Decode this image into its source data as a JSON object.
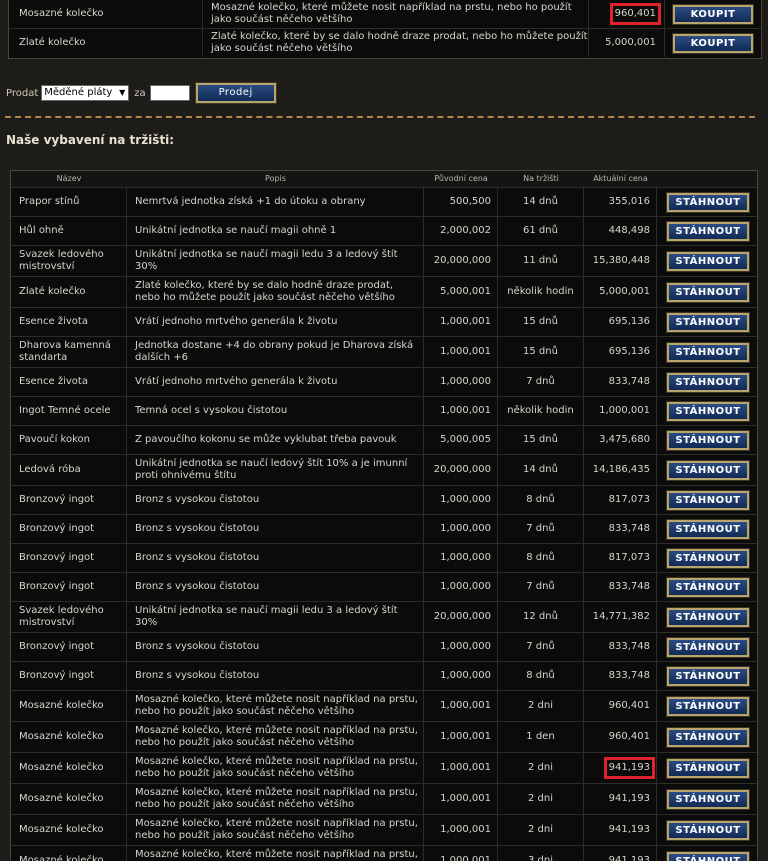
{
  "top_items": [
    {
      "name": "Mosazné kolečko",
      "desc": "Mosazné kolečko, které můžete nosit například na prstu, nebo ho použít jako součást něčeho většího",
      "price": "960,401",
      "button": "KOUPIT",
      "highlight": true
    },
    {
      "name": "Zlaté kolečko",
      "desc": "Zlaté kolečko, které by se dalo hodně draze prodat, nebo ho můžete použít jako součást něčeho většího",
      "price": "5,000,001",
      "button": "KOUPIT",
      "highlight": false
    }
  ],
  "sell": {
    "label": "Prodat",
    "selected": "Měděné pláty",
    "for_label": "za",
    "amount": "",
    "button": "Prodej"
  },
  "section_title": "Naše vybavení na tržišti:",
  "columns": {
    "name": "Název",
    "desc": "Popis",
    "orig": "Původní cena",
    "days": "Na tržišti",
    "current": "Aktuální cena"
  },
  "rows": [
    {
      "name": "Prapor stínů",
      "desc": "Nemrtvá jednotka získá +1 do útoku a obrany",
      "orig": "500,500",
      "days": "14 dnů",
      "current": "355,016",
      "button": "STÁHNOUT",
      "h": 28
    },
    {
      "name": "Hůl ohně",
      "desc": "Unikátní jednotka se naučí magii ohně 1",
      "orig": "2,000,002",
      "days": "61 dnů",
      "current": "448,498",
      "button": "STÁHNOUT",
      "h": 28
    },
    {
      "name": "Svazek ledového mistrovství",
      "desc": "Unikátní jednotka se naučí magii ledu 3 a ledový štít 30%",
      "orig": "20,000,000",
      "days": "11 dnů",
      "current": "15,380,448",
      "button": "STÁHNOUT",
      "h": 30
    },
    {
      "name": "Zlaté kolečko",
      "desc": "Zlaté kolečko, které by se dalo hodně draze prodat, nebo ho můžete použít jako součást něčeho většího",
      "orig": "5,000,001",
      "days": "několik hodin",
      "current": "5,000,001",
      "button": "STÁHNOUT",
      "h": 30
    },
    {
      "name": "Esence života",
      "desc": "Vrátí jednoho mrtvého generála k životu",
      "orig": "1,000,001",
      "days": "15 dnů",
      "current": "695,136",
      "button": "STÁHNOUT",
      "h": 28
    },
    {
      "name": "Dharova kamenná standarta",
      "desc": "Jednotka dostane +4 do obrany pokud je Dharova získá dalších +6",
      "orig": "1,000,001",
      "days": "15 dnů",
      "current": "695,136",
      "button": "STÁHNOUT",
      "h": 30
    },
    {
      "name": "Esence života",
      "desc": "Vrátí jednoho mrtvého generála k životu",
      "orig": "1,000,000",
      "days": "7 dnů",
      "current": "833,748",
      "button": "STÁHNOUT",
      "h": 28
    },
    {
      "name": "Ingot Temné ocele",
      "desc": "Temná ocel s vysokou čistotou",
      "orig": "1,000,001",
      "days": "několik hodin",
      "current": "1,000,001",
      "button": "STÁHNOUT",
      "h": 28
    },
    {
      "name": "Pavoučí kokon",
      "desc": "Z pavoučího kokonu se může vyklubat třeba pavouk",
      "orig": "5,000,005",
      "days": "15 dnů",
      "current": "3,475,680",
      "button": "STÁHNOUT",
      "h": 28
    },
    {
      "name": "Ledová róba",
      "desc": "Unikátní jednotka se naučí ledový štít 10% a je imunní proti ohnivému štítu",
      "orig": "20,000,000",
      "days": "14 dnů",
      "current": "14,186,435",
      "button": "STÁHNOUT",
      "h": 30
    },
    {
      "name": "Bronzový ingot",
      "desc": "Bronz s vysokou čistotou",
      "orig": "1,000,000",
      "days": "8 dnů",
      "current": "817,073",
      "button": "STÁHNOUT",
      "h": 28
    },
    {
      "name": "Bronzový ingot",
      "desc": "Bronz s vysokou čistotou",
      "orig": "1,000,000",
      "days": "7 dnů",
      "current": "833,748",
      "button": "STÁHNOUT",
      "h": 28
    },
    {
      "name": "Bronzový ingot",
      "desc": "Bronz s vysokou čistotou",
      "orig": "1,000,000",
      "days": "8 dnů",
      "current": "817,073",
      "button": "STÁHNOUT",
      "h": 28
    },
    {
      "name": "Bronzový ingot",
      "desc": "Bronz s vysokou čistotou",
      "orig": "1,000,000",
      "days": "7 dnů",
      "current": "833,748",
      "button": "STÁHNOUT",
      "h": 28
    },
    {
      "name": "Svazek ledového mistrovství",
      "desc": "Unikátní jednotka se naučí magii ledu 3 a ledový štít 30%",
      "orig": "20,000,000",
      "days": "12 dnů",
      "current": "14,771,382",
      "button": "STÁHNOUT",
      "h": 30
    },
    {
      "name": "Bronzový ingot",
      "desc": "Bronz s vysokou čistotou",
      "orig": "1,000,000",
      "days": "7 dnů",
      "current": "833,748",
      "button": "STÁHNOUT",
      "h": 28
    },
    {
      "name": "Bronzový ingot",
      "desc": "Bronz s vysokou čistotou",
      "orig": "1,000,000",
      "days": "8 dnů",
      "current": "833,748",
      "button": "STÁHNOUT",
      "h": 28
    },
    {
      "name": "Mosazné kolečko",
      "desc": "Mosazné kolečko, které můžete nosit například na prstu, nebo ho použít jako součást něčeho většího",
      "orig": "1,000,001",
      "days": "2 dni",
      "current": "960,401",
      "button": "STÁHNOUT",
      "h": 30
    },
    {
      "name": "Mosazné kolečko",
      "desc": "Mosazné kolečko, které můžete nosit například na prstu, nebo ho použít jako součást něčeho většího",
      "orig": "1,000,001",
      "days": "1 den",
      "current": "960,401",
      "button": "STÁHNOUT",
      "h": 30
    },
    {
      "name": "Mosazné kolečko",
      "desc": "Mosazné kolečko, které můžete nosit například na prstu, nebo ho použít jako součást něčeho většího",
      "orig": "1,000,001",
      "days": "2 dni",
      "current": "941,193",
      "button": "STÁHNOUT",
      "h": 30,
      "highlight": true
    },
    {
      "name": "Mosazné kolečko",
      "desc": "Mosazné kolečko, které můžete nosit například na prstu, nebo ho použít jako součást něčeho většího",
      "orig": "1,000,001",
      "days": "2 dni",
      "current": "941,193",
      "button": "STÁHNOUT",
      "h": 30
    },
    {
      "name": "Mosazné kolečko",
      "desc": "Mosazné kolečko, které můžete nosit například na prstu, nebo ho použít jako součást něčeho většího",
      "orig": "1,000,001",
      "days": "2 dni",
      "current": "941,193",
      "button": "STÁHNOUT",
      "h": 30
    },
    {
      "name": "Mosazné kolečko",
      "desc": "Mosazné kolečko, které můžete nosit například na prstu, nebo ho použít jako součást něčeho většího",
      "orig": "1,000,001",
      "days": "3 dni",
      "current": "941,193",
      "button": "STÁHNOUT",
      "h": 30
    }
  ],
  "colors": {
    "highlight": "#e0232b",
    "button_gold": "#b7a56d",
    "button_blue": "#1b3a6e",
    "divider": "#b0864a"
  }
}
